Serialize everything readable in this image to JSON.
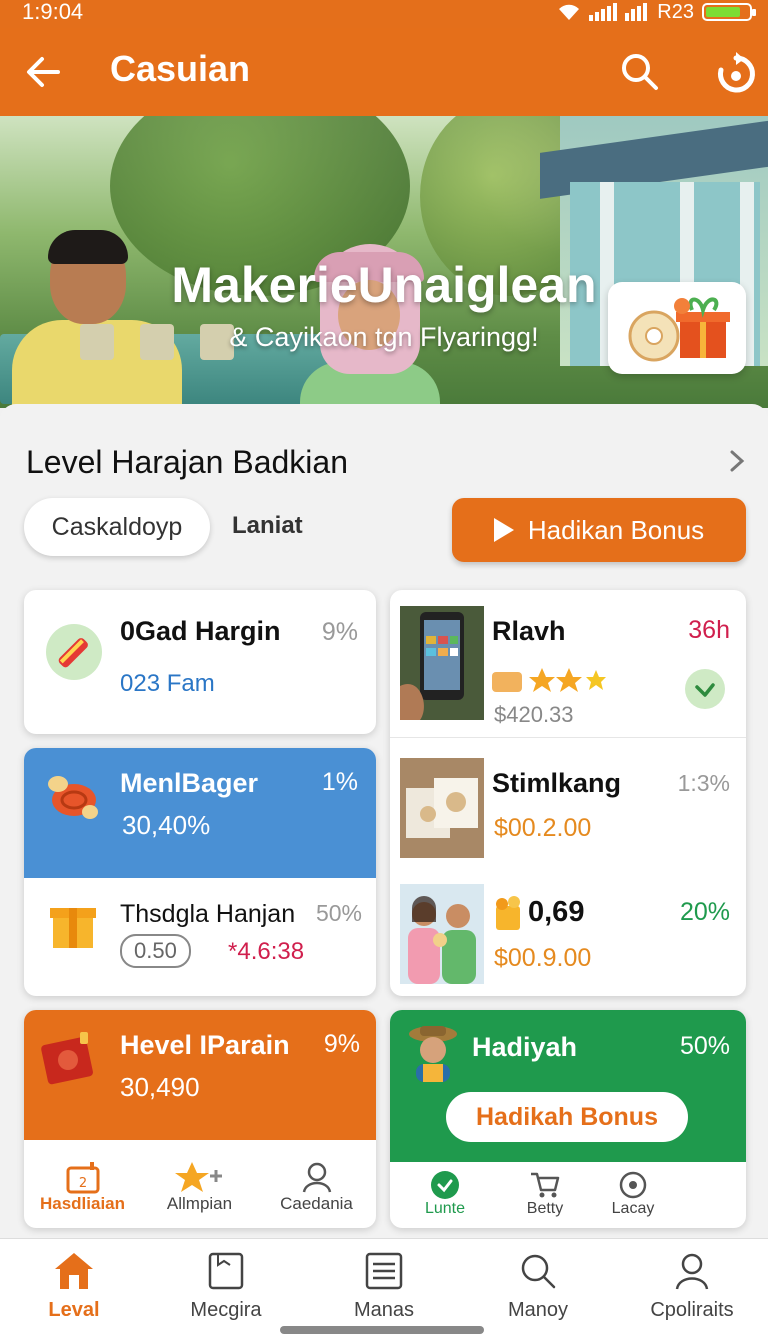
{
  "status_bar": {
    "time": "1:9:04",
    "carrier": "R23"
  },
  "app_bar": {
    "title": "Casuian",
    "icons": [
      "back-arrow-icon",
      "search-icon",
      "refresh-icon"
    ]
  },
  "hero": {
    "headline": "MakerieUnaiglean",
    "subline": "& Cayikaon tgn Flyaringg!"
  },
  "section": {
    "title": "Level Harajan Badkian",
    "chip_label": "Caskaldoyp",
    "tab_label": "Laniat",
    "bonus_button": "Hadikan Bonus"
  },
  "cards": {
    "c1": {
      "title": "0Gad Hargin",
      "pct": "9%",
      "sub": "023 Fam"
    },
    "c2": {
      "title": "Rlavh",
      "time": "36h",
      "price": "$420.33"
    },
    "c3": {
      "title": "MenlBager",
      "pct": "1%",
      "value": "30,40%"
    },
    "c4": {
      "title": "Stimlkang",
      "pct": "1:3%",
      "price": "$00.2.00"
    },
    "c5": {
      "title": "Thsdgla Hanjan",
      "pct": "50%",
      "badge": "0.50",
      "value": "*4.6:38"
    },
    "c6": {
      "value": "0,69",
      "pct": "20%",
      "price": "$00.9.00"
    },
    "c7": {
      "title": "Hevel IParain",
      "pct": "9%",
      "value": "30,490",
      "tabs": [
        "Hasdliaian",
        "Allmpian",
        "Caedania"
      ]
    },
    "c8": {
      "title": "Hadiyah",
      "pct": "50%",
      "button": "Hadikah Bonus",
      "tabs": [
        "Lunte",
        "Betty",
        "Lacay"
      ]
    }
  },
  "bottom_nav": {
    "items": [
      {
        "label": "Leval",
        "icon": "home-icon",
        "active": true
      },
      {
        "label": "Mecgira",
        "icon": "document-icon",
        "active": false
      },
      {
        "label": "Manas",
        "icon": "list-icon",
        "active": false
      },
      {
        "label": "Manoy",
        "icon": "search-icon",
        "active": false
      },
      {
        "label": "Cpoliraits",
        "icon": "profile-icon",
        "active": false
      }
    ]
  },
  "colors": {
    "primary": "#e56f1a",
    "blue": "#4a90d4",
    "green": "#1f9a4d",
    "red": "#d01f4d"
  }
}
